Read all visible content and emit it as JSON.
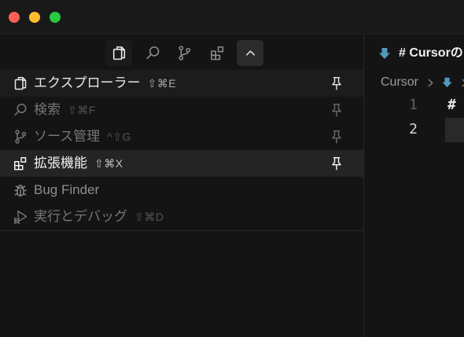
{
  "colors": {
    "traffic_close": "#ff5f57",
    "traffic_minimize": "#febc2e",
    "traffic_zoom": "#28c840",
    "markdown_icon": "#519aba"
  },
  "activity_bar": {
    "items": [
      {
        "icon": "files-icon",
        "active": true
      },
      {
        "icon": "search-icon",
        "active": false
      },
      {
        "icon": "source-control-icon",
        "active": false
      },
      {
        "icon": "extensions-icon",
        "active": false
      }
    ],
    "toggle_icon": "chevron-up-icon"
  },
  "views_menu": {
    "items": [
      {
        "icon": "files-icon",
        "label": "エクスプローラー",
        "shortcut": "⇧⌘E",
        "pin_icon": "pin-icon",
        "selected": true
      },
      {
        "icon": "search-icon",
        "label": "検索",
        "shortcut": "⇧⌘F",
        "pin_icon": "pin-icon"
      },
      {
        "icon": "source-control-icon",
        "label": "ソース管理",
        "shortcut": "^⇧G",
        "pin_icon": "pin-icon"
      },
      {
        "icon": "extensions-icon",
        "label": "拡張機能",
        "shortcut": "⇧⌘X",
        "pin_icon": "pin-icon",
        "hovered": true
      },
      {
        "icon": "bug-icon",
        "label": "Bug Finder"
      },
      {
        "icon": "run-debug-icon",
        "label": "実行とデバッグ",
        "shortcut": "⇧⌘D"
      }
    ]
  },
  "editor": {
    "tab": {
      "icon": "markdown-icon",
      "label": "# Cursorの"
    },
    "breadcrumb": {
      "folder": "Cursor",
      "file_icon": "markdown-icon"
    },
    "lines": [
      {
        "number": "1",
        "text": "#"
      },
      {
        "number": "2",
        "text": ""
      }
    ],
    "current_line": 2
  }
}
